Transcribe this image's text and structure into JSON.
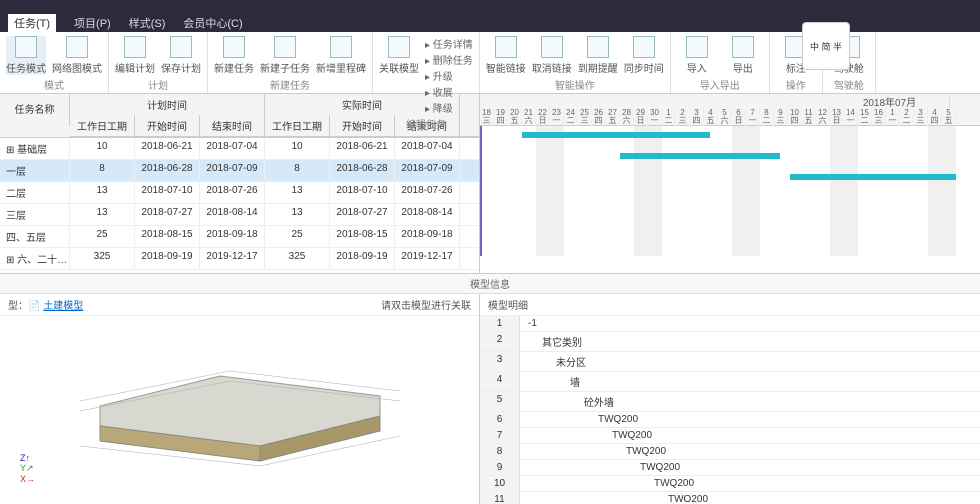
{
  "menu": {
    "tasks": "任务(T)",
    "project": "项目(P)",
    "style": "样式(S)",
    "member": "会员中心(C)"
  },
  "ribbon": {
    "groups": [
      {
        "name": "模式",
        "btns": [
          {
            "l": "任务模式"
          },
          {
            "l": "网络图模式"
          }
        ]
      },
      {
        "name": "计划",
        "btns": [
          {
            "l": "编辑计划"
          },
          {
            "l": "保存计划"
          }
        ]
      },
      {
        "name": "新建任务",
        "btns": [
          {
            "l": "新建任务"
          },
          {
            "l": "新建子任务"
          },
          {
            "l": "新增里程碑"
          }
        ]
      },
      {
        "name": "编辑任务",
        "btns": [
          {
            "l": "关联模型"
          }
        ],
        "mini": [
          "任务详情",
          "删除任务",
          "升级",
          "收展",
          "降级"
        ]
      },
      {
        "name": "智能操作",
        "btns": [
          {
            "l": "智能链接"
          },
          {
            "l": "取消链接"
          },
          {
            "l": "到期提醒"
          },
          {
            "l": "同步时间"
          }
        ]
      },
      {
        "name": "导入导出",
        "btns": [
          {
            "l": "导入"
          },
          {
            "l": "导出"
          }
        ]
      },
      {
        "name": "操作",
        "btns": [
          {
            "l": "标注"
          }
        ]
      },
      {
        "name": "驾驶舱",
        "btns": [
          {
            "l": "驾驶舱"
          }
        ]
      }
    ],
    "avatar": "中\n简\n半"
  },
  "grid": {
    "nameHdr": "任务名称",
    "planHdr": "计划时间",
    "actualHdr": "实际时间",
    "cols": [
      "工作日工期",
      "开始时间",
      "结束时间",
      "工作日工期",
      "开始时间",
      "结束时间"
    ],
    "rows": [
      {
        "n": "基础层",
        "d": [
          "10",
          "2018-06-21",
          "2018-07-04",
          "10",
          "2018-06-21",
          "2018-07-04"
        ]
      },
      {
        "n": "一层",
        "d": [
          "8",
          "2018-06-28",
          "2018-07-09",
          "8",
          "2018-06-28",
          "2018-07-09"
        ],
        "sel": true
      },
      {
        "n": "二层",
        "d": [
          "13",
          "2018-07-10",
          "2018-07-26",
          "13",
          "2018-07-10",
          "2018-07-26"
        ]
      },
      {
        "n": "三层",
        "d": [
          "13",
          "2018-07-27",
          "2018-08-14",
          "13",
          "2018-07-27",
          "2018-08-14"
        ]
      },
      {
        "n": "四、五层",
        "d": [
          "25",
          "2018-08-15",
          "2018-09-18",
          "25",
          "2018-08-15",
          "2018-09-18"
        ]
      },
      {
        "n": "六、二十…",
        "d": [
          "325",
          "2018-09-19",
          "2019-12-17",
          "325",
          "2018-09-19",
          "2019-12-17"
        ]
      }
    ]
  },
  "gantt": {
    "month": "2018年07月",
    "days": [
      "18",
      "19",
      "20",
      "21",
      "22",
      "23",
      "24",
      "25",
      "26",
      "27",
      "28",
      "29",
      "30",
      "1",
      "2",
      "3",
      "4",
      "5",
      "6",
      "7",
      "8",
      "9",
      "10",
      "11",
      "12",
      "13",
      "14",
      "15",
      "16",
      "1",
      "2",
      "3",
      "4",
      "5"
    ],
    "wk": [
      "三",
      "四",
      "五",
      "六",
      "日",
      "一",
      "二",
      "三",
      "四",
      "五",
      "六",
      "日",
      "一",
      "二",
      "三",
      "四",
      "五",
      "六",
      "日",
      "一",
      "二",
      "三",
      "四",
      "五",
      "六",
      "日",
      "一",
      "二",
      "三",
      "一",
      "二",
      "三",
      "四",
      "五"
    ]
  },
  "split": "模型信息",
  "bl": {
    "modelType": "型：",
    "modelLink": "土建模型",
    "hint": "请双击模型进行关联"
  },
  "br": {
    "title": "模型明细",
    "rows": [
      {
        "i": "1",
        "v": "-1"
      },
      {
        "i": "2",
        "v": "其它类别"
      },
      {
        "i": "3",
        "v": "未分区"
      },
      {
        "i": "4",
        "v": "墙"
      },
      {
        "i": "5",
        "v": "砼外墙"
      },
      {
        "i": "6",
        "v": "TWQ200"
      },
      {
        "i": "7",
        "v": "TWQ200"
      },
      {
        "i": "8",
        "v": "TWQ200"
      },
      {
        "i": "9",
        "v": "TWQ200"
      },
      {
        "i": "10",
        "v": "TWQ200"
      },
      {
        "i": "11",
        "v": "TWO200"
      }
    ]
  }
}
